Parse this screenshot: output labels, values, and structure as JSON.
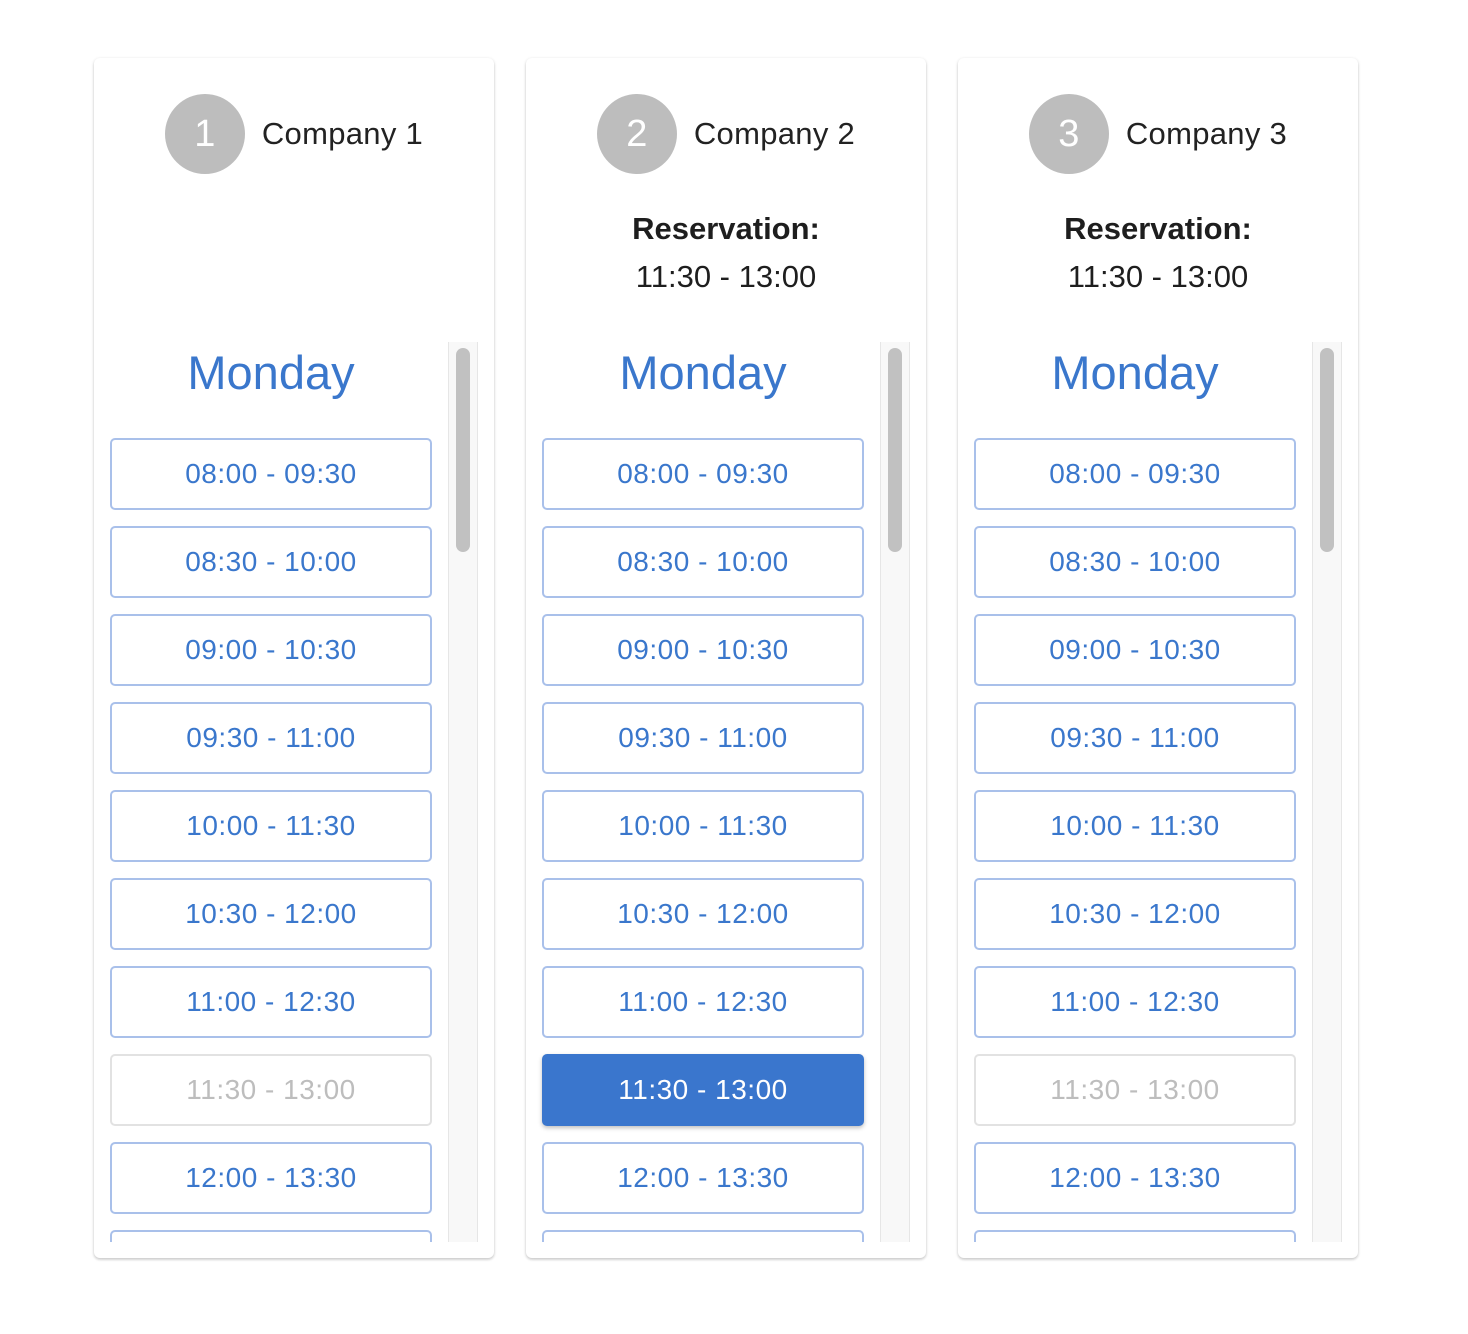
{
  "day": "Monday",
  "companies": [
    {
      "step": "1",
      "name": "Company 1",
      "reservation": null,
      "slots": [
        {
          "label": "08:00 - 09:30",
          "state": "available"
        },
        {
          "label": "08:30 - 10:00",
          "state": "available"
        },
        {
          "label": "09:00 - 10:30",
          "state": "available"
        },
        {
          "label": "09:30 - 11:00",
          "state": "available"
        },
        {
          "label": "10:00 - 11:30",
          "state": "available"
        },
        {
          "label": "10:30 - 12:00",
          "state": "available"
        },
        {
          "label": "11:00 - 12:30",
          "state": "available"
        },
        {
          "label": "11:30 - 13:00",
          "state": "disabled"
        },
        {
          "label": "12:00 - 13:30",
          "state": "available"
        },
        {
          "label": "",
          "state": "available"
        }
      ]
    },
    {
      "step": "2",
      "name": "Company 2",
      "reservation": {
        "label": "Reservation:",
        "value": "11:30 - 13:00"
      },
      "slots": [
        {
          "label": "08:00 - 09:30",
          "state": "available"
        },
        {
          "label": "08:30 - 10:00",
          "state": "available"
        },
        {
          "label": "09:00 - 10:30",
          "state": "available"
        },
        {
          "label": "09:30 - 11:00",
          "state": "available"
        },
        {
          "label": "10:00 - 11:30",
          "state": "available"
        },
        {
          "label": "10:30 - 12:00",
          "state": "available"
        },
        {
          "label": "11:00 - 12:30",
          "state": "available"
        },
        {
          "label": "11:30 - 13:00",
          "state": "selected"
        },
        {
          "label": "12:00 - 13:30",
          "state": "available"
        },
        {
          "label": "",
          "state": "available"
        }
      ]
    },
    {
      "step": "3",
      "name": "Company 3",
      "reservation": {
        "label": "Reservation:",
        "value": "11:30 - 13:00"
      },
      "slots": [
        {
          "label": "08:00 - 09:30",
          "state": "available"
        },
        {
          "label": "08:30 - 10:00",
          "state": "available"
        },
        {
          "label": "09:00 - 10:30",
          "state": "available"
        },
        {
          "label": "09:30 - 11:00",
          "state": "available"
        },
        {
          "label": "10:00 - 11:30",
          "state": "available"
        },
        {
          "label": "10:30 - 12:00",
          "state": "available"
        },
        {
          "label": "11:00 - 12:30",
          "state": "available"
        },
        {
          "label": "11:30 - 13:00",
          "state": "disabled"
        },
        {
          "label": "12:00 - 13:30",
          "state": "available"
        },
        {
          "label": "",
          "state": "available"
        }
      ]
    }
  ],
  "colors": {
    "accent": "#3a77cc",
    "step_circle": "#bdbdbd",
    "disabled_text": "#bdbdbd",
    "slot_border": "#a9c0ea"
  }
}
